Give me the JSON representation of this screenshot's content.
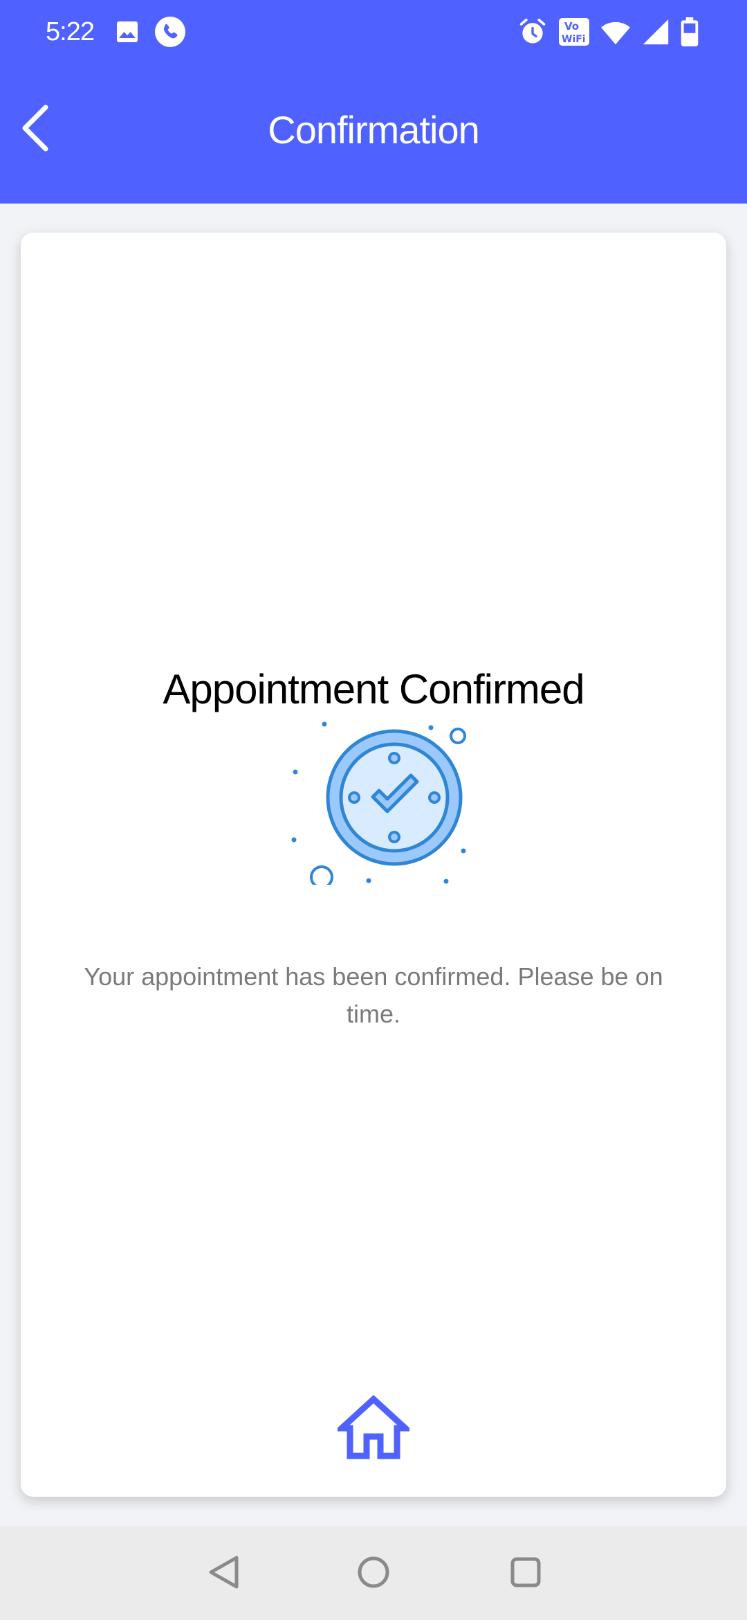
{
  "status_bar": {
    "time": "5:22",
    "left_icons": [
      "image-icon",
      "phone-call-icon"
    ],
    "right_icons": [
      "alarm-icon",
      "vowifi-icon",
      "wifi-icon",
      "signal-icon",
      "battery-icon"
    ],
    "vowifi_text_top": "Vo",
    "vowifi_text_bottom": "WiFi"
  },
  "app_bar": {
    "title": "Confirmation",
    "color": "#4f61ff"
  },
  "confirmation": {
    "title": "Appointment Confirmed",
    "message": "Your appointment has been confirmed. Please be on time.",
    "illustration": "clock-check-icon",
    "accent_color": "#2f86d6",
    "fill_color": "#9cc9fb"
  },
  "home": {
    "icon": "home-icon",
    "color": "#4f61ff"
  },
  "navigation": {
    "buttons": [
      "back-triangle-icon",
      "home-circle-icon",
      "recents-square-icon"
    ]
  }
}
